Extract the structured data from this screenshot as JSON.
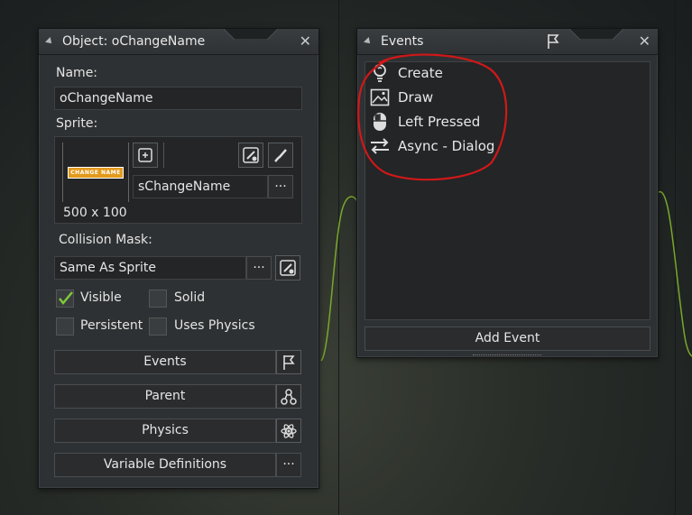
{
  "object_panel": {
    "title": "Object: oChangeName",
    "name_label": "Name:",
    "name_value": "oChangeName",
    "sprite_label": "Sprite:",
    "sprite_thumb_text": "CHANGE NAME",
    "sprite_name": "sChangeName",
    "sprite_size": "500 x 100",
    "collision_label": "Collision Mask:",
    "collision_value": "Same As Sprite",
    "more_label": "···",
    "checkboxes": [
      {
        "label": "Visible",
        "checked": true
      },
      {
        "label": "Solid",
        "checked": false
      },
      {
        "label": "Persistent",
        "checked": false
      },
      {
        "label": "Uses Physics",
        "checked": false
      }
    ],
    "buttons": [
      {
        "label": "Events",
        "icon": "flag-icon"
      },
      {
        "label": "Parent",
        "icon": "hierarchy-icon"
      },
      {
        "label": "Physics",
        "icon": "atom-icon"
      },
      {
        "label": "Variable Definitions",
        "icon": "more-icon"
      }
    ]
  },
  "events_panel": {
    "title": "Events",
    "items": [
      {
        "label": "Create",
        "icon": "lightbulb-icon"
      },
      {
        "label": "Draw",
        "icon": "picture-icon"
      },
      {
        "label": "Left Pressed",
        "icon": "mouse-icon"
      },
      {
        "label": "Async - Dialog",
        "icon": "async-arrows-icon"
      }
    ],
    "add_event_label": "Add Event"
  },
  "colors": {
    "accent_green": "#8fbf2a",
    "annotation_red": "#d01818",
    "thumb_orange": "#e39a1c"
  }
}
